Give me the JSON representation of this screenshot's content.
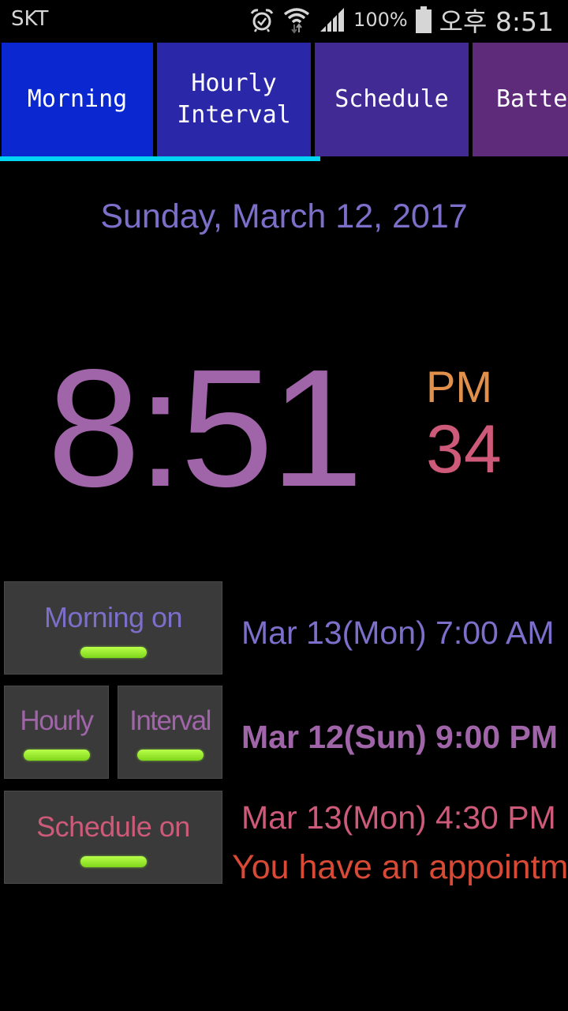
{
  "status_bar": {
    "carrier": "SKT",
    "icons": [
      "alarm-clock-icon",
      "wifi-icon",
      "signal-icon",
      "battery-icon"
    ],
    "battery_percent": "100%",
    "time": "오후 8:51"
  },
  "tabs": [
    {
      "label": "Morning",
      "color": "#0b27cf",
      "selected": true
    },
    {
      "label": "Hourly\nInterval",
      "color": "#2a28a8",
      "selected": false
    },
    {
      "label": "Schedule",
      "color": "#422a94",
      "selected": false
    },
    {
      "label": "Batte",
      "color": "#5e2a7a",
      "selected": false
    }
  ],
  "date": "Sunday, March 12, 2017",
  "clock": {
    "time": "8:51",
    "ampm": "PM",
    "seconds": "34"
  },
  "toggles": {
    "morning": {
      "label": "Morning on",
      "state": "on"
    },
    "hourly": {
      "label": "Hourly",
      "state": "on"
    },
    "interval": {
      "label": "Interval",
      "state": "on"
    },
    "schedule": {
      "label": "Schedule on",
      "state": "on"
    }
  },
  "next_alarms": {
    "morning": "Mar 13(Mon) 7:00 AM",
    "hourly": "Mar 12(Sun) 9:00 PM",
    "schedule": "Mar 13(Mon) 4:30 PM",
    "schedule_message": "You have an appointment"
  },
  "colors": {
    "accent_indicator": "#00d4f2",
    "morning": "#7b6fc9",
    "hourly": "#a065a8",
    "schedule": "#cc5a78",
    "ampm": "#e0904a",
    "message": "#d84a35",
    "toggle_on": "#9be82a"
  }
}
